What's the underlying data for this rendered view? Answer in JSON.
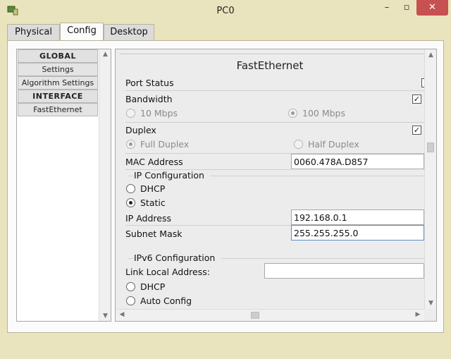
{
  "window": {
    "title": "PC0",
    "minimize": "–",
    "maximize": "▫",
    "close": "✕"
  },
  "tabs": [
    {
      "label": "Physical"
    },
    {
      "label": "Config"
    },
    {
      "label": "Desktop"
    }
  ],
  "nav": {
    "items": [
      {
        "label": "GLOBAL"
      },
      {
        "label": "Settings"
      },
      {
        "label": "Algorithm Settings"
      },
      {
        "label": "INTERFACE"
      },
      {
        "label": "FastEthernet"
      }
    ]
  },
  "panel": {
    "title": "FastEthernet",
    "port_status": "Port Status",
    "bandwidth": "Bandwidth",
    "bw_10": "10 Mbps",
    "bw_100": "100 Mbps",
    "duplex": "Duplex",
    "full_duplex": "Full Duplex",
    "half_duplex": "Half Duplex",
    "mac_label": "MAC Address",
    "mac_value": "0060.478A.D857",
    "ip_config": "IP Configuration",
    "dhcp": "DHCP",
    "static": "Static",
    "ip_label": "IP Address",
    "ip_value": "192.168.0.1",
    "mask_label": "Subnet Mask",
    "mask_value": "255.255.255.0",
    "ipv6_config": "IPv6 Configuration",
    "link_local": "Link Local Address:",
    "link_local_value": "",
    "v6_dhcp": "DHCP",
    "auto_config": "Auto Config",
    "check_mark": "✓"
  },
  "colors": {
    "window_bg": "#eae4be",
    "close_btn": "#c75050",
    "field_focus": "#5b8fc7"
  }
}
